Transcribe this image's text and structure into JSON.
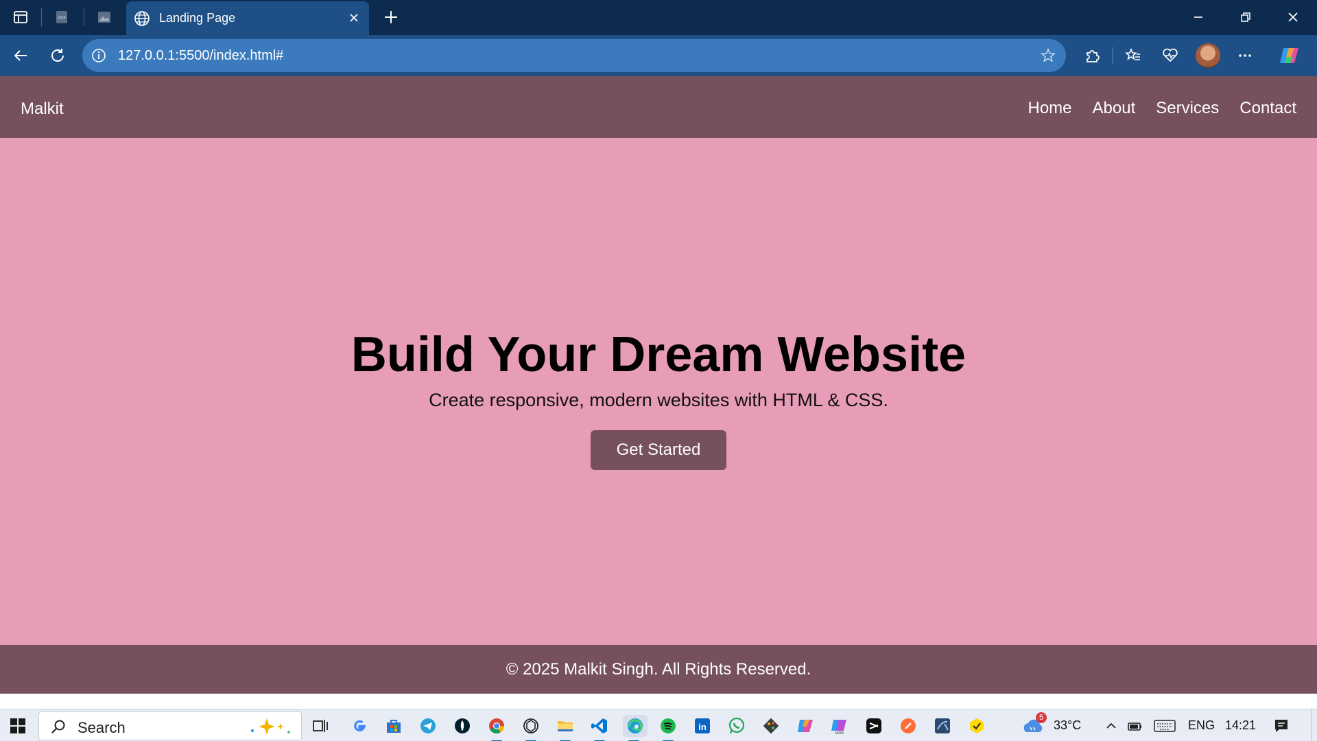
{
  "browser": {
    "tab_title": "Landing Page",
    "address": "127.0.0.1:5500/index.html#"
  },
  "site": {
    "logo": "Malkit",
    "nav": [
      "Home",
      "About",
      "Services",
      "Contact"
    ],
    "hero_title": "Build Your Dream Website",
    "hero_subtitle": "Create responsive, modern websites with HTML & CSS.",
    "cta_label": "Get Started",
    "footer": "© 2025 Malkit Singh. All Rights Reserved."
  },
  "taskbar": {
    "search_placeholder": "Search",
    "weather": "33°C",
    "weather_badge": "5",
    "language": "ENG",
    "time": "14:21"
  },
  "colors": {
    "page_bg": "#e79cb8",
    "nav_bg": "#76505d",
    "browser_frame": "#0d2b4e",
    "toolbar": "#1e4f86"
  }
}
